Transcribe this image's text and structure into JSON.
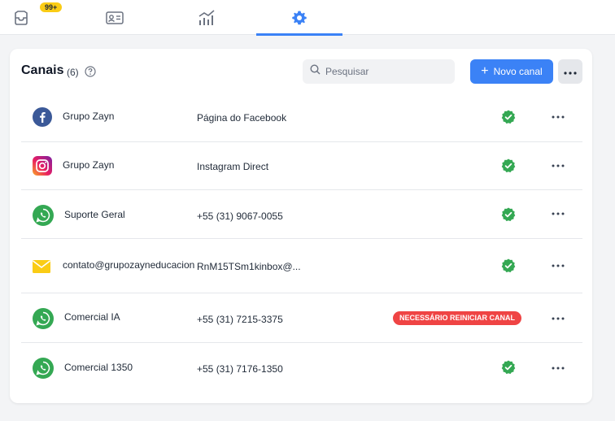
{
  "nav": {
    "badge": "99+",
    "tabs": [
      {
        "name": "inbox",
        "icon": "inbox-icon"
      },
      {
        "name": "contacts",
        "icon": "contact-card-icon"
      },
      {
        "name": "reports",
        "icon": "chart-icon"
      },
      {
        "name": "settings",
        "icon": "gear-icon",
        "active": true
      }
    ],
    "accent": "#3b82f6"
  },
  "header": {
    "title": "Canais",
    "count": "(6)",
    "search_placeholder": "Pesquisar",
    "new_button_label": "Novo canal"
  },
  "channels": [
    {
      "name": "Grupo Zayn",
      "detail": "Página do Facebook",
      "icon": "facebook-icon",
      "status": "ok"
    },
    {
      "name": "Grupo Zayn",
      "detail": "Instagram Direct",
      "icon": "instagram-icon",
      "status": "ok"
    },
    {
      "name": "Suporte Geral",
      "detail": "+55 (31) 9067-0055",
      "icon": "whatsapp-icon",
      "status": "ok"
    },
    {
      "name": "contato@grupozayneducacion...",
      "detail": "RnM15TSm1kinbox@...",
      "icon": "mail-icon",
      "status": "ok"
    },
    {
      "name": "Comercial IA",
      "detail": "+55 (31) 7215-3375",
      "icon": "whatsapp-icon",
      "status": "error",
      "status_label": "NECESSÁRIO REINICIAR CANAL"
    },
    {
      "name": "Comercial 1350",
      "detail": "+55 (31) 7176-1350",
      "icon": "whatsapp-icon",
      "status": "ok"
    }
  ],
  "colors": {
    "success": "#34a853",
    "error": "#ef4444",
    "whatsapp": "#34a853",
    "facebook": "#3b5998",
    "mail": "#facc15"
  }
}
